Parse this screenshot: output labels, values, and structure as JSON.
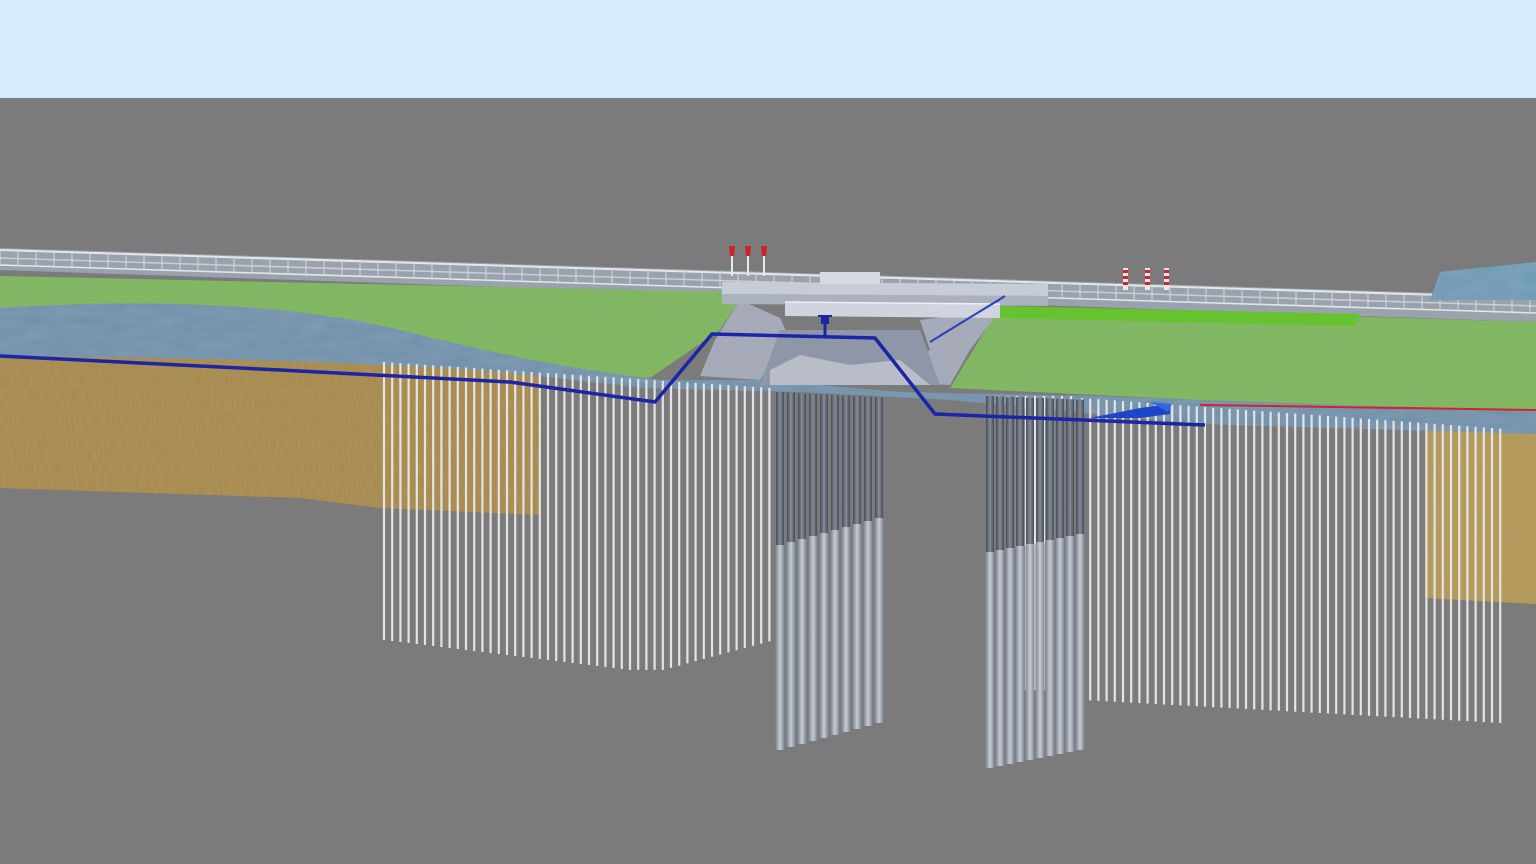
{
  "scene": {
    "colors": {
      "sky": "#d4ecfb",
      "background": "#7b7b7b",
      "grass": "#7cb35b",
      "grass_bright": "#67c22f",
      "water": "#6f8fa6",
      "soil": "#a98a4c",
      "pile_light": "#e4e4e4",
      "pile_grey": "#9ba3ad",
      "pile_dark": "#5f6672",
      "pipe": "#1b25a6",
      "gate": "#c7ccd7",
      "signal_red": "#d2232a"
    },
    "icons": [
      "red-flag-icon",
      "striped-marker-icon",
      "flow-arrow-icon"
    ]
  }
}
